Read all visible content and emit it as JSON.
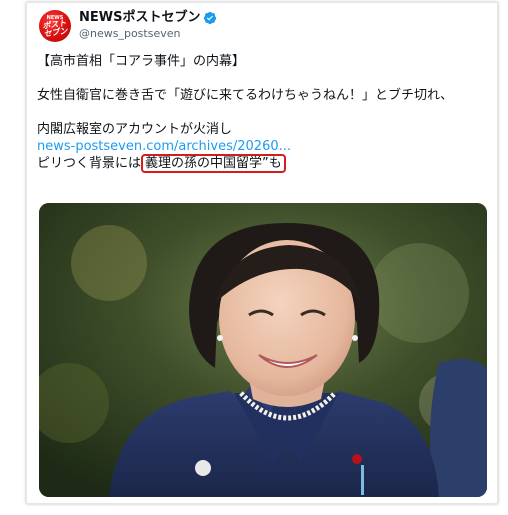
{
  "account": {
    "avatar_top": "NEWS",
    "avatar_main": "ポスト\nセブン",
    "display_name": "NEWSポストセブン",
    "handle": "@news_postseven",
    "verified": true
  },
  "tweet": {
    "line1": "【高市首相「コアラ事件」の内幕】",
    "line2": "女性自衛官に巻き舌で「遊びに来てるわけちゃうねん！」とブチ切れ、",
    "line3": "内閣広報室のアカウントが火消し",
    "link": "news-postseven.com/archives/20260...",
    "line5_prefix": "ピリつく背景には",
    "line5_highlight": "義理の孫の中国留学",
    "line5_suffix": "”も"
  },
  "colors": {
    "link": "#1d9bf0",
    "highlight_border": "#d31d1d",
    "verified": "#1d9bf0",
    "avatar": "#d70f0f"
  },
  "image": {
    "description_icon": "photo-woman-smiling"
  }
}
